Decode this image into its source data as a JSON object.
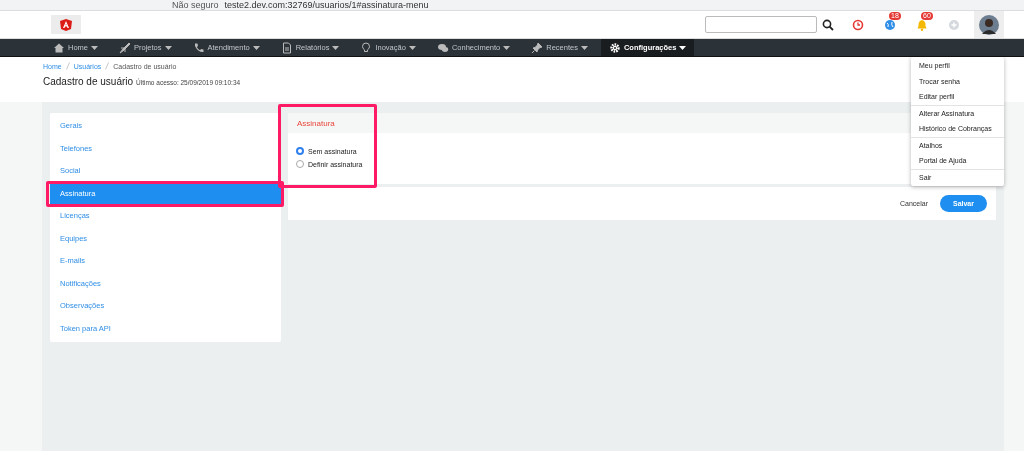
{
  "browser": {
    "security": "Não seguro",
    "url": "teste2.dev.com:32769/usuarios/1#assinatura-menu"
  },
  "header": {
    "badges": [
      {
        "kind": "clock"
      },
      {
        "kind": "globe",
        "count": "18"
      },
      {
        "kind": "bell",
        "count": "60"
      },
      {
        "kind": "plus"
      }
    ]
  },
  "nav": [
    {
      "label": "Home",
      "selected": false
    },
    {
      "label": "Projetos",
      "selected": false
    },
    {
      "label": "Atendimento",
      "selected": false
    },
    {
      "label": "Relatórios",
      "selected": false
    },
    {
      "label": "Inovação",
      "selected": false
    },
    {
      "label": "Conhecimento",
      "selected": false
    },
    {
      "label": "Recentes",
      "selected": false
    },
    {
      "label": "Configurações",
      "selected": true
    }
  ],
  "breadcrumb": [
    {
      "label": "Home",
      "link": true
    },
    {
      "label": "Usuários",
      "link": true
    },
    {
      "label": "Cadastro de usuário",
      "link": false
    }
  ],
  "page": {
    "title": "Cadastro de usuário",
    "subtitle": "Último acesso: 25/09/2019 09:10:34"
  },
  "sidebar": {
    "items": [
      {
        "label": "Gerais",
        "selected": false
      },
      {
        "label": "Telefones",
        "selected": false
      },
      {
        "label": "Social",
        "selected": false
      },
      {
        "label": "Assinatura",
        "selected": true
      },
      {
        "label": "Licenças",
        "selected": false
      },
      {
        "label": "Equipes",
        "selected": false
      },
      {
        "label": "E-mails",
        "selected": false
      },
      {
        "label": "Notificações",
        "selected": false
      },
      {
        "label": "Observações",
        "selected": false
      },
      {
        "label": "Token para API",
        "selected": false
      }
    ]
  },
  "panel": {
    "title": "Assinatura",
    "options": [
      {
        "label": "Sem assinatura",
        "selected": true
      },
      {
        "label": "Definir assinatura",
        "selected": false
      }
    ],
    "buttons": [
      {
        "label": "Cancelar",
        "kind": "link"
      },
      {
        "label": "Salvar",
        "kind": "primary"
      }
    ]
  },
  "user_menu": {
    "groups": [
      [
        "Meu perfil",
        "Trocar senha",
        "Editar perfil"
      ],
      [
        "Alterar Assinatura",
        "Histórico de Cobranças"
      ],
      [
        "Atalhos",
        "Portal de Ajuda"
      ],
      [
        "Sair"
      ]
    ]
  }
}
